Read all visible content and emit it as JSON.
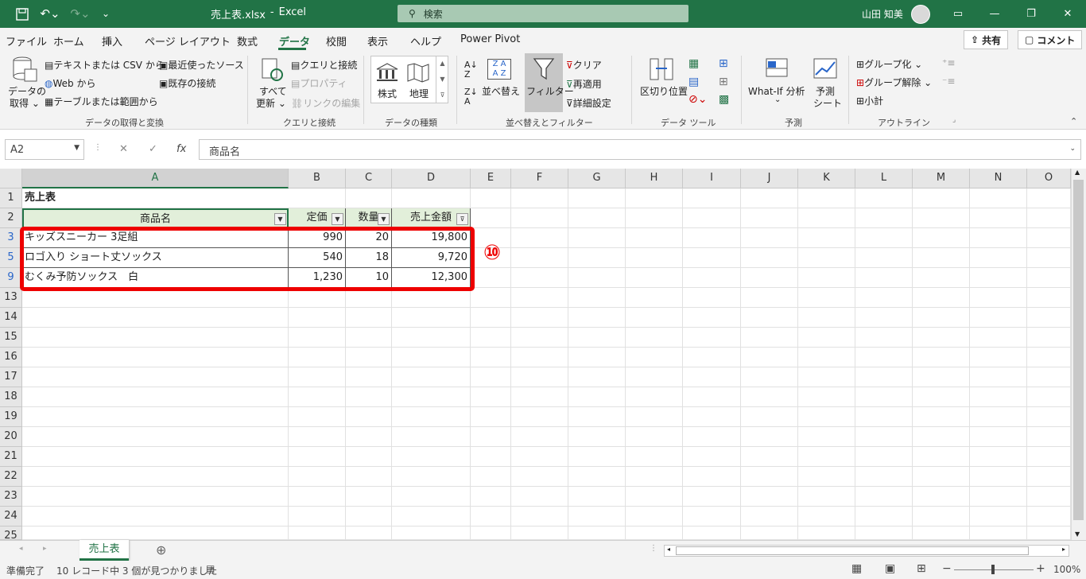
{
  "title": {
    "filename": "売上表.xlsx",
    "separator": "-",
    "app": "Excel",
    "search_placeholder": "検索",
    "user": "山田 知美"
  },
  "menu": [
    "ファイル",
    "ホーム",
    "挿入",
    "ページ レイアウト",
    "数式",
    "データ",
    "校閲",
    "表示",
    "ヘルプ",
    "Power Pivot"
  ],
  "menu_active": "データ",
  "share": "共有",
  "comment": "コメント",
  "ribbon": {
    "get_data": {
      "line1": "データの",
      "line2": "取得 ⌄",
      "text_csv": "テキストまたは CSV から",
      "web": "Web から",
      "table": "テーブルまたは範囲から",
      "recent": "最近使ったソース",
      "existing": "既存の接続",
      "label": "データの取得と変換"
    },
    "queries": {
      "refresh1": "すべて",
      "refresh2": "更新 ⌄",
      "queries": "クエリと接続",
      "properties": "プロパティ",
      "edit_links": "リンクの編集",
      "label": "クエリと接続"
    },
    "types": {
      "stocks": "株式",
      "geo": "地理",
      "label": "データの種類"
    },
    "sort": {
      "sort": "並べ替え",
      "filter": "フィルター",
      "clear": "クリア",
      "reapply": "再適用",
      "advanced": "詳細設定",
      "label": "並べ替えとフィルター"
    },
    "tools": {
      "text_to_cols": "区切り位置",
      "label": "データ ツール"
    },
    "forecast": {
      "whatif": "What-If 分析",
      "whatif2": "⌄",
      "sheet1": "予測",
      "sheet2": "シート",
      "label": "予測"
    },
    "outline": {
      "group": "グループ化",
      "ungroup": "グループ解除",
      "subtotal": "小計",
      "label": "アウトライン"
    }
  },
  "formula_bar": {
    "namebox": "A2",
    "cancel": "✕",
    "enter": "✓",
    "fx": "fx",
    "content": "商品名"
  },
  "columns": [
    "A",
    "B",
    "C",
    "D",
    "E",
    "F",
    "G",
    "H",
    "I",
    "J",
    "K",
    "L",
    "M",
    "N",
    "O"
  ],
  "row_numbers": [
    "1",
    "2",
    "3",
    "5",
    "9",
    "13",
    "14",
    "15",
    "16",
    "17",
    "18",
    "19",
    "20",
    "21",
    "22",
    "23",
    "24",
    "25"
  ],
  "cells": {
    "a1": "売上表",
    "headers": [
      "商品名",
      "定価",
      "数量",
      "売上金額"
    ],
    "rows": [
      [
        "キッズスニーカー 3足組",
        "990",
        "20",
        "19,800"
      ],
      [
        "ロゴ入り ショート丈ソックス",
        "540",
        "18",
        "9,720"
      ],
      [
        "むくみ予防ソックス　白",
        "1,230",
        "10",
        "12,300"
      ]
    ]
  },
  "annotation": "⑩",
  "sheet_tab": "売上表",
  "status": {
    "ready": "準備完了",
    "records": "10 レコード中 3 個が見つかりました",
    "zoom": "100%"
  }
}
